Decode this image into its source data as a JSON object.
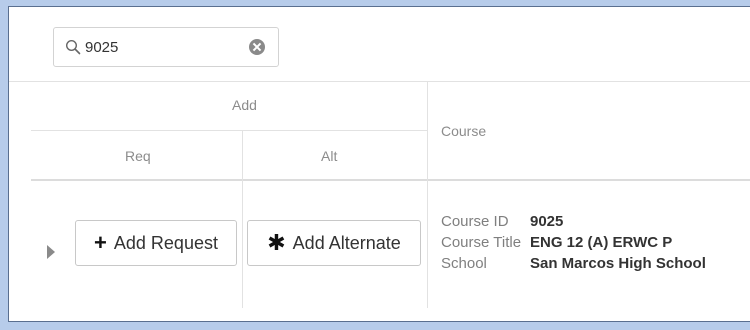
{
  "search": {
    "value": "9025",
    "placeholder": ""
  },
  "table": {
    "headers": {
      "add_group": "Add",
      "req": "Req",
      "alt": "Alt",
      "course": "Course"
    },
    "rows": [
      {
        "add_request_label": "Add Request",
        "add_alternate_label": "Add Alternate",
        "course_id_label": "Course ID",
        "course_id": "9025",
        "course_title_label": "Course Title",
        "course_title": "ENG 12 (A) ERWC P",
        "school_label": "School",
        "school": "San Marcos High School"
      }
    ]
  },
  "icons": {
    "search": "search-icon",
    "clear": "clear-circle-x-icon",
    "expand": "caret-right-icon",
    "add": "plus-icon",
    "alternate": "asterisk-icon"
  }
}
